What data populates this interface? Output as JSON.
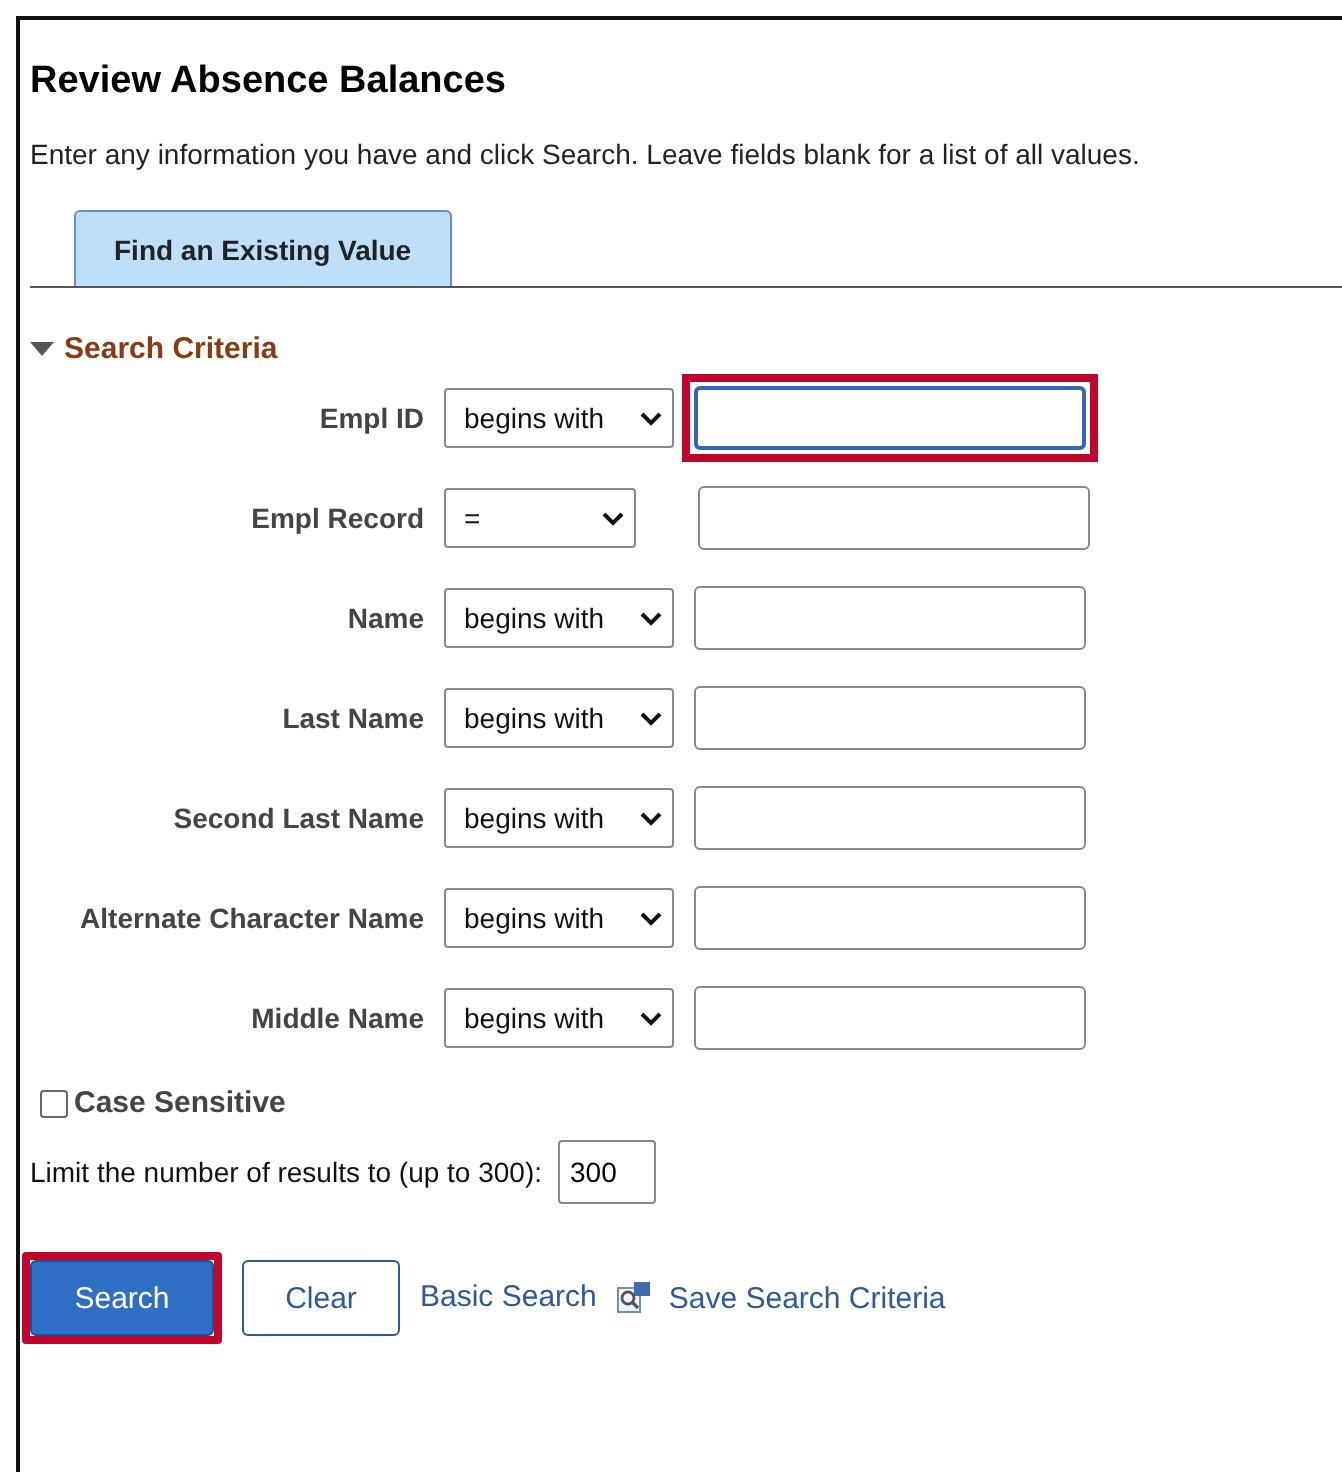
{
  "title": "Review Absence Balances",
  "instructions": "Enter any information you have and click Search. Leave fields blank for a list of all values.",
  "tabs": [
    {
      "label": "Find an Existing Value",
      "selected": true
    }
  ],
  "search_criteria": {
    "label": "Search Criteria",
    "expanded": true,
    "fields": [
      {
        "label": "Empl ID",
        "operator": "begins with",
        "focused": true,
        "highlighted": true
      },
      {
        "label": "Empl Record",
        "operator": "=",
        "focused": false,
        "highlighted": false
      },
      {
        "label": "Name",
        "operator": "begins with",
        "focused": false,
        "highlighted": false
      },
      {
        "label": "Last Name",
        "operator": "begins with",
        "focused": false,
        "highlighted": false
      },
      {
        "label": "Second Last Name",
        "operator": "begins with",
        "focused": false,
        "highlighted": false
      },
      {
        "label": "Alternate Character Name",
        "operator": "begins with",
        "focused": false,
        "highlighted": false
      },
      {
        "label": "Middle Name",
        "operator": "begins with",
        "focused": false,
        "highlighted": false
      }
    ]
  },
  "case_sensitive": {
    "label": "Case Sensitive",
    "checked": false
  },
  "limit": {
    "label": "Limit the number of results to (up to 300):",
    "value": "300"
  },
  "actions": [
    {
      "kind": "primary",
      "label": "Search",
      "highlighted": true
    },
    {
      "kind": "secondary",
      "label": "Clear",
      "highlighted": false
    },
    {
      "kind": "link",
      "label": "Basic Search",
      "highlighted": false
    },
    {
      "kind": "icon-link",
      "label": "Save Search Criteria",
      "highlighted": false
    }
  ]
}
